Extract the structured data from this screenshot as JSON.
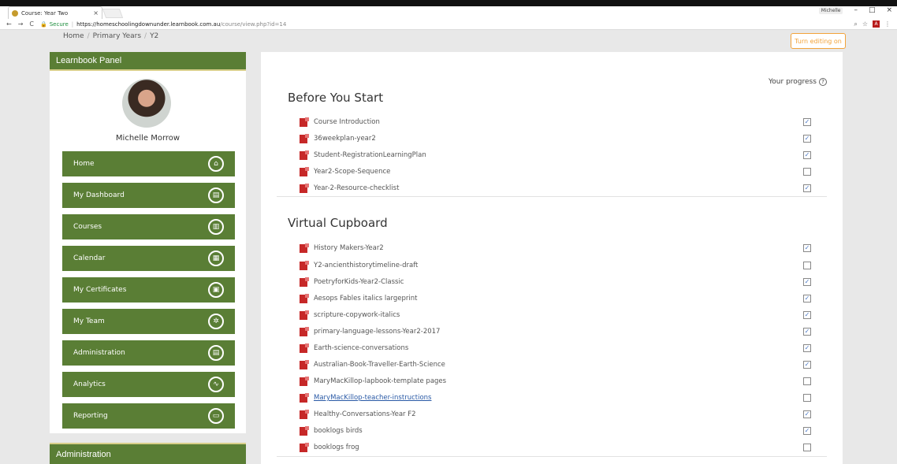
{
  "browser": {
    "tab_title": "Course: Year Two",
    "tab_close": "×",
    "profile": "Michelle",
    "window_controls": [
      "–",
      "□",
      "×"
    ],
    "nav": [
      "←",
      "→",
      "C"
    ],
    "secure_label": "Secure",
    "url_main": "https://homeschoolingdownunder.learnbook.com.au",
    "url_path": "/course/view.php?id=14",
    "pdf_label": "A"
  },
  "breadcrumb": [
    "Home",
    "Primary Years",
    "Y2"
  ],
  "edit_button": "Turn editing on",
  "panel": {
    "title": "Learnbook Panel",
    "user_name": "Michelle Morrow",
    "menu": [
      {
        "label": "Home",
        "icon": "⌂"
      },
      {
        "label": "My Dashboard",
        "icon": "▤"
      },
      {
        "label": "Courses",
        "icon": "▥"
      },
      {
        "label": "Calendar",
        "icon": "▦"
      },
      {
        "label": "My Certificates",
        "icon": "▣"
      },
      {
        "label": "My Team",
        "icon": "✲"
      },
      {
        "label": "Administration",
        "icon": "▤"
      },
      {
        "label": "Analytics",
        "icon": "∿"
      },
      {
        "label": "Reporting",
        "icon": "▭"
      }
    ]
  },
  "panel2_title": "Administration",
  "progress_label": "Your progress",
  "progress_help": "?",
  "sections": [
    {
      "title": "Before You Start",
      "activities": [
        {
          "name": "Course Introduction",
          "done": true,
          "link": false
        },
        {
          "name": "36weekplan-year2",
          "done": true,
          "link": false
        },
        {
          "name": "Student-RegistrationLearningPlan",
          "done": true,
          "link": false
        },
        {
          "name": "Year2-Scope-Sequence",
          "done": false,
          "link": false
        },
        {
          "name": "Year-2-Resource-checklist",
          "done": true,
          "link": false
        }
      ]
    },
    {
      "title": "Virtual Cupboard",
      "activities": [
        {
          "name": "History Makers-Year2",
          "done": true,
          "link": false
        },
        {
          "name": "Y2-ancienthistorytimeline-draft",
          "done": false,
          "link": false
        },
        {
          "name": "PoetryforKids-Year2-Classic",
          "done": true,
          "link": false
        },
        {
          "name": "Aesops Fables italics largeprint",
          "done": true,
          "link": false
        },
        {
          "name": "scripture-copywork-italics",
          "done": true,
          "link": false
        },
        {
          "name": "primary-language-lessons-Year2-2017",
          "done": true,
          "link": false
        },
        {
          "name": "Earth-science-conversations",
          "done": true,
          "link": false
        },
        {
          "name": "Australian-Book-Traveller-Earth-Science",
          "done": true,
          "link": false
        },
        {
          "name": "MaryMacKillop-lapbook-template pages",
          "done": false,
          "link": false
        },
        {
          "name": "MaryMacKillop-teacher-instructions",
          "done": false,
          "link": true
        },
        {
          "name": "Healthy-Conversations-Year F2",
          "done": true,
          "link": false
        },
        {
          "name": "booklogs birds",
          "done": true,
          "link": false
        },
        {
          "name": "booklogs frog",
          "done": false,
          "link": false
        }
      ]
    }
  ],
  "check_mark": "✓"
}
